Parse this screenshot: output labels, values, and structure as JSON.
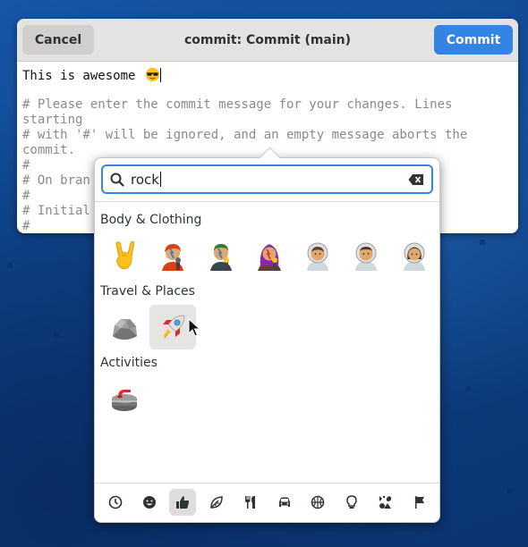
{
  "window": {
    "title": "commit: Commit (main)",
    "cancel_label": "Cancel",
    "commit_label": "Commit"
  },
  "editor": {
    "first_line": "This is awesome ",
    "comment_lines": [
      "# Please enter the commit message for your changes. Lines starting",
      "# with '#' will be ignored, and an empty message aborts the commit.",
      "#",
      "# On bran",
      "#",
      "# Initial",
      "#"
    ]
  },
  "emoji_chooser": {
    "search_value": "rock",
    "sections": [
      {
        "label": "Body & Clothing",
        "emojis": [
          "sign-of-the-horns",
          "singer",
          "man-singer",
          "woman-singer",
          "astronaut",
          "man-astronaut",
          "woman-astronaut"
        ]
      },
      {
        "label": "Travel & Places",
        "emojis": [
          "rock",
          "rocket"
        ]
      },
      {
        "label": "Activities",
        "emojis": [
          "curling-stone"
        ]
      }
    ],
    "categories": [
      "recent-icon",
      "smileys-icon",
      "body-icon",
      "nature-icon",
      "food-icon",
      "travel-icon",
      "activities-icon",
      "objects-icon",
      "symbols-icon",
      "flags-icon"
    ],
    "active_category": "body-icon",
    "hovered_emoji": "rocket"
  },
  "colors": {
    "accent": "#3584e4",
    "desktop_background": "#0d3f82"
  }
}
